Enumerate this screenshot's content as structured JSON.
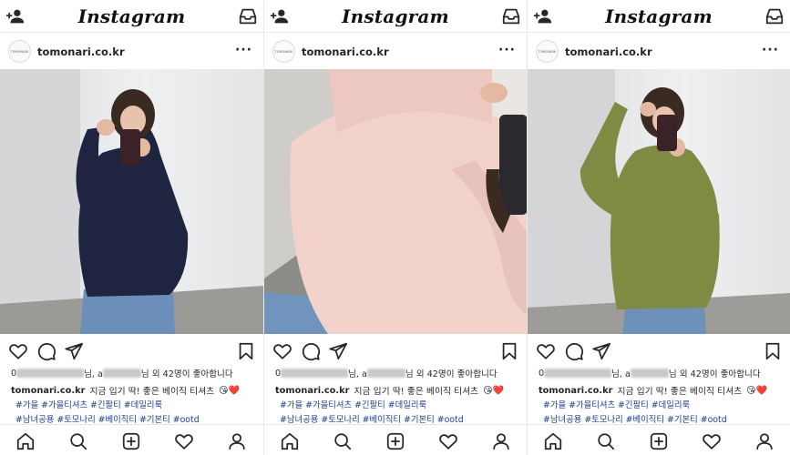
{
  "app": {
    "logo_text": "Instagram"
  },
  "posts": [
    {
      "username": "tomonari.co.kr",
      "avatar_text": "TOMONARI",
      "likes_sep": "님, a",
      "likes_text": "님 외 42명이 좋아합니다",
      "caption_user": "tomonari.co.kr",
      "caption_text": "지금 입기 딱! 좋은 베이직 티셔츠",
      "emojis": "😘❤️",
      "tags_line1": "#가을 #가을티셔츠 #긴팔티 #데일리룩",
      "tags_line2": "#남녀공용 #토모나리 #베이직티 #기본티 #ootd",
      "sweater_color": "#1f2540"
    },
    {
      "username": "tomonari.co.kr",
      "avatar_text": "TOMONARI",
      "likes_sep": "님, a",
      "likes_text": "님 외 42명이 좋아합니다",
      "caption_user": "tomonari.co.kr",
      "caption_text": "지금 입기 딱! 좋은 베이직 티셔츠",
      "emojis": "😘❤️",
      "tags_line1": "#가을 #가을티셔츠 #긴팔티 #데일리룩",
      "tags_line2": "#남녀공용 #토모나리 #베이직티 #기본티 #ootd",
      "sweater_color": "#f1d3cc"
    },
    {
      "username": "tomonari.co.kr",
      "avatar_text": "TOMONARI",
      "likes_sep": "님, a",
      "likes_text": "님 외 42명이 좋아합니다",
      "caption_user": "tomonari.co.kr",
      "caption_text": "지금 입기 딱! 좋은 베이직 티셔츠",
      "emojis": "😘❤️",
      "tags_line1": "#가을 #가을티셔츠 #긴팔티 #데일리룩",
      "tags_line2": "#남녀공용 #토모나리 #베이직티 #기본티 #ootd",
      "sweater_color": "#7f8a43"
    }
  ],
  "icons": {
    "top_left": "add-user-icon",
    "top_right": "inbox-icon",
    "actions": [
      "heart-icon",
      "comment-icon",
      "share-icon",
      "bookmark-icon"
    ],
    "nav": [
      "home-icon",
      "search-icon",
      "add-post-icon",
      "activity-icon",
      "profile-icon"
    ]
  },
  "colors": {
    "hashtag": "#1f3f8f",
    "text": "#262626",
    "divider": "#ededed"
  }
}
